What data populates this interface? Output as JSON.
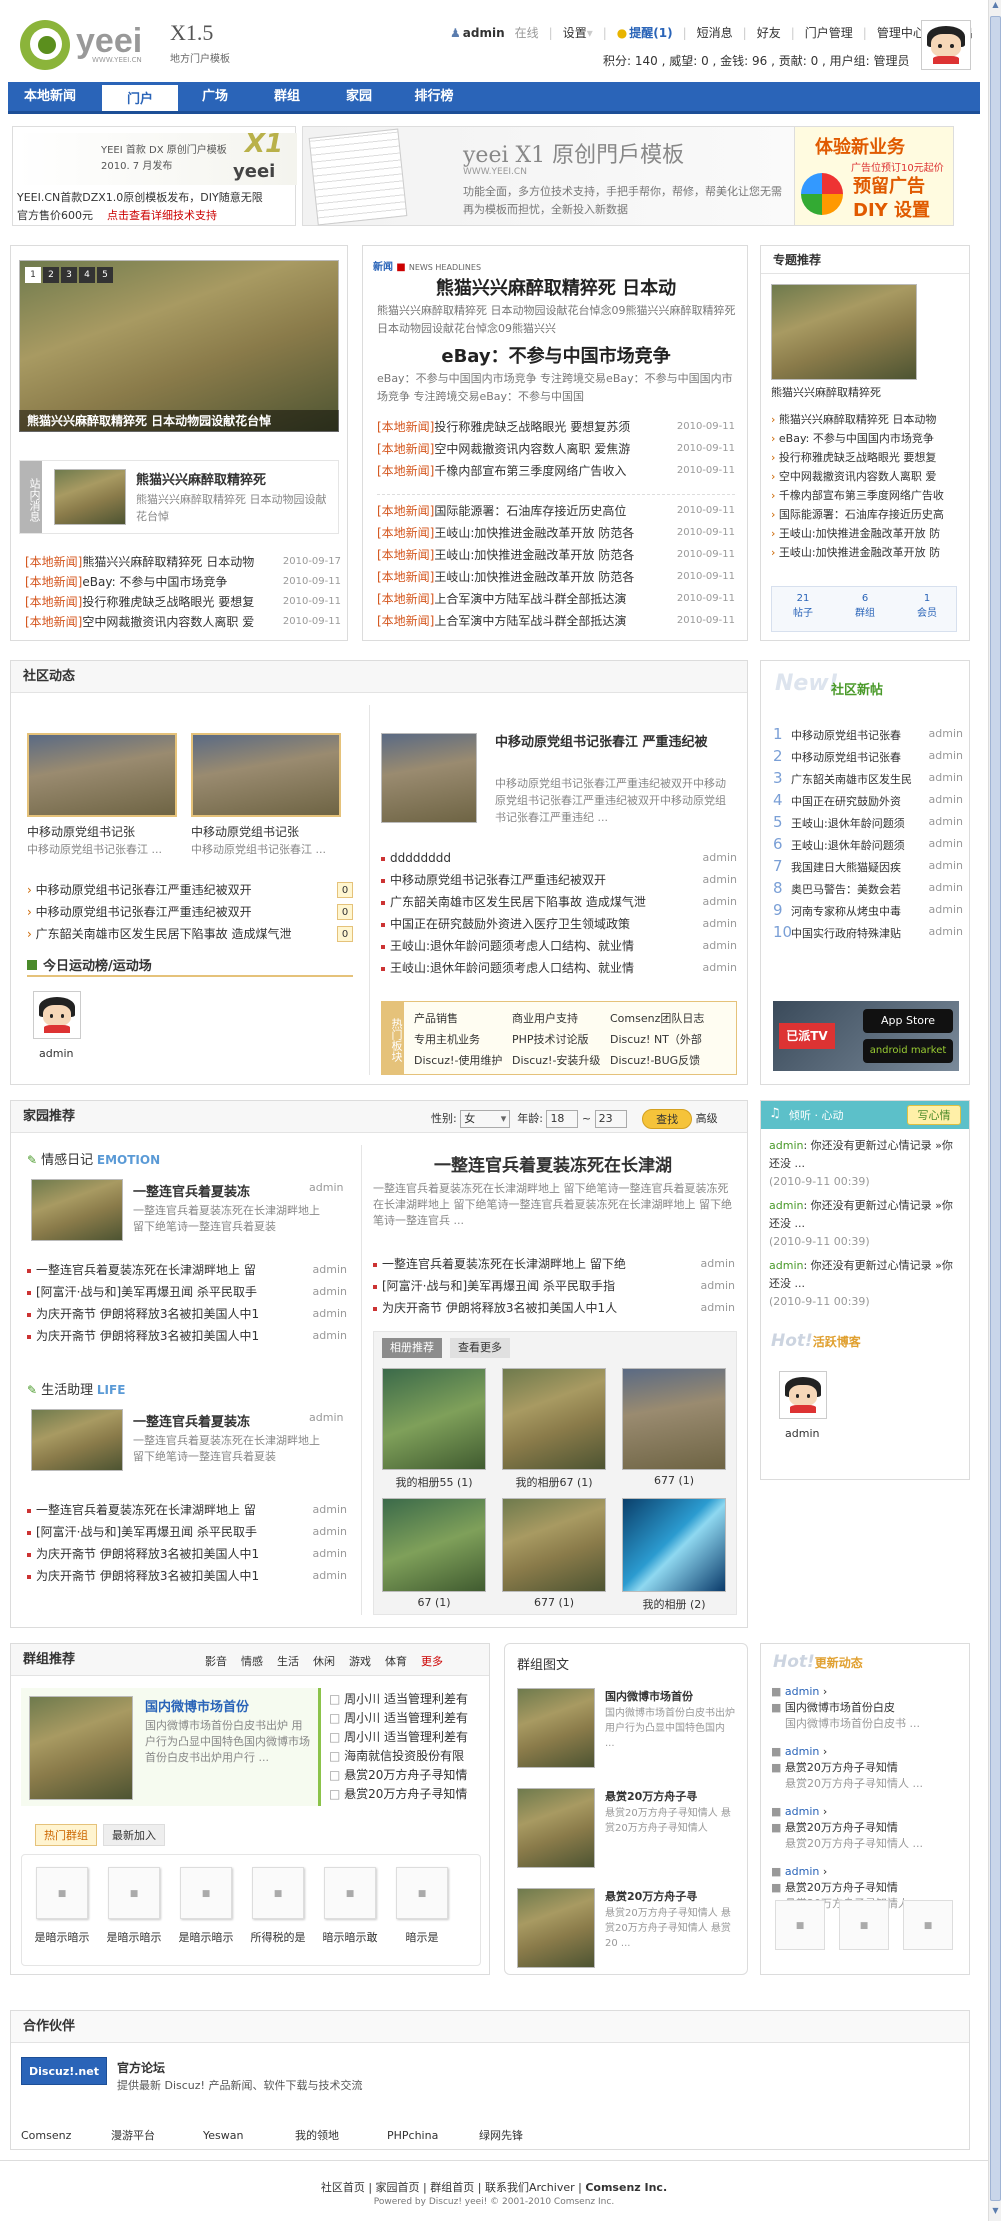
{
  "header": {
    "logo_text": "yeei",
    "logo_ver": "X1.5",
    "logo_sub": "地方门户模板",
    "logo_url": "WWW.YEEI.CN",
    "user": "admin",
    "online": "在线",
    "settings": "设置",
    "remind": "提醒(1)",
    "sms": "短消息",
    "friends": "好友",
    "portal_admin": "门户管理",
    "admin_center": "管理中心",
    "logout": "退出",
    "stats": "积分: 140 , 威望: 0 , 金钱: 96 , 贡献: 0 , 用户组: 管理员"
  },
  "nav": [
    "本地新闻",
    "门户",
    "广场",
    "群组",
    "家园",
    "排行榜"
  ],
  "ads": {
    "a1_title": "YEEI 首款 DX 原创门户模板",
    "a1_date": "2010. 7 月发布",
    "a1_x1": "X1",
    "a1_logo": "yeei",
    "a1_line1": "YEEI.CN首款DZX1.0原创模板发布，DIY随意无限",
    "a1_line2": "官方售价600元",
    "a1_link": "点击查看详细技术支持",
    "a2_title": "yeei X1 原创門戶模板",
    "a2_url": "WWW.YEEI.CN",
    "a2_text": "功能全面，多方位技术支持，手把手帮你，帮修，帮美化让您无需再为模板而担忧，全新投入新数据",
    "a3_title": "体验新业务",
    "a3_sub": "广告位预订10元起价",
    "a3_big": "预留广告 DIY 设置"
  },
  "slider": {
    "nums": [
      "1",
      "2",
      "3",
      "4",
      "5"
    ],
    "caption": "熊猫兴兴麻醉取精猝死  日本动物园设献花台悼"
  },
  "station": {
    "tab": "站内消息",
    "title": "熊猫兴兴麻醉取精猝死",
    "desc": "熊猫兴兴麻醉取精猝死 日本动物园设献花台悼",
    "items": [
      {
        "tag": "[本地新闻]",
        "t": "熊猫兴兴麻醉取精猝死 日本动物",
        "d": "2010-09-17"
      },
      {
        "tag": "[本地新闻]",
        "t": "eBay: 不参与中国市场竞争",
        "d": "2010-09-11"
      },
      {
        "tag": "[本地新闻]",
        "t": "投行称雅虎缺乏战略眼光 要想复",
        "d": "2010-09-11"
      },
      {
        "tag": "[本地新闻]",
        "t": "空中网裁撤资讯内容数人离职 爱",
        "d": "2010-09-11"
      }
    ]
  },
  "news": {
    "label": "新闻",
    "label2": "NEWS HEADLINES",
    "head1": "熊猫兴兴麻醉取精猝死  日本动",
    "sum1": "熊猫兴兴麻醉取精猝死 日本动物园设献花台悼念09熊猫兴兴麻醉取精猝死 日本动物园设献花台悼念09熊猫兴兴",
    "head2": "eBay：不参与中国市场竞争",
    "sum2": "eBay：不参与中国国内市场竞争 专注跨境交易eBay：不参与中国国内市场竞争 专注跨境交易eBay：不参与中国国",
    "list1": [
      {
        "tag": "[本地新闻]",
        "t": "投行称雅虎缺乏战略眼光 要想复苏须",
        "d": "2010-09-11"
      },
      {
        "tag": "[本地新闻]",
        "t": "空中网裁撤资讯内容数人离职 爱焦游",
        "d": "2010-09-11"
      },
      {
        "tag": "[本地新闻]",
        "t": "千橡内部宣布第三季度网络广告收入",
        "d": "2010-09-11"
      }
    ],
    "list2": [
      {
        "tag": "[本地新闻]",
        "t": "国际能源署：石油库存接近历史高位",
        "d": "2010-09-11"
      },
      {
        "tag": "[本地新闻]",
        "t": "王岐山:加快推进金融改革开放 防范各",
        "d": "2010-09-11"
      },
      {
        "tag": "[本地新闻]",
        "t": "王岐山:加快推进金融改革开放 防范各",
        "d": "2010-09-11"
      },
      {
        "tag": "[本地新闻]",
        "t": "王岐山:加快推进金融改革开放 防范各",
        "d": "2010-09-11"
      },
      {
        "tag": "[本地新闻]",
        "t": "上合军演中方陆军战斗群全部抵达演",
        "d": "2010-09-11"
      },
      {
        "tag": "[本地新闻]",
        "t": "上合军演中方陆军战斗群全部抵达演",
        "d": "2010-09-11"
      }
    ]
  },
  "topic": {
    "title": "专题推荐",
    "caption": "熊猫兴兴麻醉取精猝死",
    "items": [
      "熊猫兴兴麻醉取精猝死 日本动物",
      "eBay: 不参与中国国内市场竞争",
      "投行称雅虎缺乏战略眼光 要想复",
      "空中网裁撤资讯内容数人离职 爱",
      "千橡内部宣布第三季度网络广告收",
      "国际能源署：石油库存接近历史高",
      "王岐山:加快推进金融改革开放 防",
      "王岐山:加快推进金融改革开放 防"
    ],
    "stats": [
      {
        "n": "21",
        "l": "帖子"
      },
      {
        "n": "6",
        "l": "群组"
      },
      {
        "n": "1",
        "l": "会员"
      }
    ]
  },
  "community": {
    "title": "社区动态",
    "pic1": "中移动原党组书记张",
    "pic1b": "中移动原党组书记张春江 ...",
    "pic2": "中移动原党组书记张",
    "pic2b": "中移动原党组书记张春江 ...",
    "list": [
      {
        "t": "中移动原党组书记张春江严重违纪被双开",
        "n": "0"
      },
      {
        "t": "中移动原党组书记张春江严重违纪被双开",
        "n": "0"
      },
      {
        "t": "广东韶关南雄市区发生民居下陷事故 造成煤气泄",
        "n": "0"
      }
    ],
    "today": "今日运动榜/运动场",
    "today_user": "admin",
    "feat_title": "中移动原党组书记张春江 严重违纪被",
    "feat_desc": "中移动原党组书记张春江严重违纪被双开中移动原党组书记张春江严重违纪被双开中移动原党组书记张春江严重违纪 ...",
    "list2": [
      {
        "t": "dddddddd",
        "u": "admin"
      },
      {
        "t": "中移动原党组书记张春江严重违纪被双开",
        "u": "admin"
      },
      {
        "t": "广东韶关南雄市区发生民居下陷事故 造成煤气泄",
        "u": "admin"
      },
      {
        "t": "中国正在研究鼓励外资进入医疗卫生领域政策",
        "u": "admin"
      },
      {
        "t": "王岐山:退休年龄问题须考虑人口结构、就业情",
        "u": "admin"
      },
      {
        "t": "王岐山:退休年龄问题须考虑人口结构、就业情",
        "u": "admin"
      }
    ],
    "hot_tab": "热门板块",
    "hot": [
      [
        "产品销售",
        "商业用户支持",
        "Comsenz团队日志"
      ],
      [
        "专用主机业务",
        "PHP技术讨论版",
        "Discuz! NT（外部"
      ],
      [
        "Discuz!-使用维护",
        "Discuz!-安装升级",
        "Discuz!-BUG反馈"
      ]
    ]
  },
  "new_posts": {
    "title": "社区新帖",
    "items": [
      {
        "n": "1",
        "t": "中移动原党组书记张春",
        "u": "admin"
      },
      {
        "n": "2",
        "t": "中移动原党组书记张春",
        "u": "admin"
      },
      {
        "n": "3",
        "t": "广东韶关南雄市区发生民",
        "u": "admin"
      },
      {
        "n": "4",
        "t": "中国正在研究鼓励外资",
        "u": "admin"
      },
      {
        "n": "5",
        "t": "王岐山:退休年龄问题须",
        "u": "admin"
      },
      {
        "n": "6",
        "t": "王岐山:退休年龄问题须",
        "u": "admin"
      },
      {
        "n": "7",
        "t": "我国建日大熊猫疑因疾",
        "u": "admin"
      },
      {
        "n": "8",
        "t": "奥巴马警告：美数会若",
        "u": "admin"
      },
      {
        "n": "9",
        "t": "河南专家称从烤虫中毒",
        "u": "admin"
      },
      {
        "n": "10",
        "t": "中国实行政府特殊津贴",
        "u": "admin"
      }
    ],
    "app_store": "App Store",
    "android": "android market",
    "brand": "已派TV"
  },
  "home": {
    "title": "家园推荐",
    "gender_label": "性别:",
    "gender": "女",
    "age_label": "年龄:",
    "age_from": "18",
    "age_to": "23",
    "search": "查找",
    "advanced": "高级",
    "cat1": "情感日记",
    "cat1_en": "EMOTION",
    "feat1_title": "一整连官兵着夏装冻",
    "feat1_user": "admin",
    "feat1_desc": "一整连官兵着夏装冻死在长津湖畔地上 留下绝笔诗一整连官兵着夏装",
    "list1": [
      {
        "t": "一整连官兵着夏装冻死在长津湖畔地上 留",
        "u": "admin"
      },
      {
        "t": "[阿富汗·战与和]美军再爆丑闻 杀平民取手",
        "u": "admin"
      },
      {
        "t": "为庆开斋节 伊朗将释放3名被扣美国人中1",
        "u": "admin"
      },
      {
        "t": "为庆开斋节 伊朗将释放3名被扣美国人中1",
        "u": "admin"
      }
    ],
    "cat2": "生活助理",
    "cat2_en": "LIFE",
    "feat2_title": "一整连官兵着夏装冻",
    "feat2_user": "admin",
    "feat2_desc": "一整连官兵着夏装冻死在长津湖畔地上 留下绝笔诗一整连官兵着夏装",
    "list2": [
      {
        "t": "一整连官兵着夏装冻死在长津湖畔地上 留",
        "u": "admin"
      },
      {
        "t": "[阿富汗·战与和]美军再爆丑闻 杀平民取手",
        "u": "admin"
      },
      {
        "t": "为庆开斋节 伊朗将释放3名被扣美国人中1",
        "u": "admin"
      },
      {
        "t": "为庆开斋节 伊朗将释放3名被扣美国人中1",
        "u": "admin"
      }
    ],
    "center_title": "一整连官兵着夏装冻死在长津湖",
    "center_desc": "一整连官兵着夏装冻死在长津湖畔地上 留下绝笔诗一整连官兵着夏装冻死在长津湖畔地上 留下绝笔诗一整连官兵着夏装冻死在长津湖畔地上 留下绝笔诗一整连官兵 ...",
    "center_list": [
      {
        "t": "一整连官兵着夏装冻死在长津湖畔地上 留下绝",
        "u": "admin"
      },
      {
        "t": "[阿富汗·战与和]美军再爆丑闻 杀平民取手指",
        "u": "admin"
      },
      {
        "t": "为庆开斋节 伊朗将释放3名被扣美国人中1人",
        "u": "admin"
      }
    ],
    "album_tab": "相册推荐",
    "album_more": "查看更多",
    "albums": [
      "我的相册55 (1)",
      "我的相册67 (1)",
      "677 (1)",
      "67 (1)",
      "677 (1)",
      "我的相册 (2)"
    ]
  },
  "mood": {
    "title": "倾听 · 心动",
    "button": "写心情",
    "items": [
      {
        "u": "admin",
        "t": ": 你还没有更新过心情记录 &raquo;你还没 ...",
        "d": "(2010-9-11 00:39)"
      },
      {
        "u": "admin",
        "t": ": 你还没有更新过心情记录 &raquo;你还没 ...",
        "d": "(2010-9-11 00:39)"
      },
      {
        "u": "admin",
        "t": ": 你还没有更新过心情记录 &raquo;你还没 ...",
        "d": "(2010-9-11 00:39)"
      }
    ],
    "hot_title": "活跃博客",
    "hot_en": "Hot!",
    "hot_user": "admin"
  },
  "groups": {
    "title": "群组推荐",
    "cats": [
      "影音",
      "情感",
      "生活",
      "休闲",
      "游戏",
      "体育",
      "更多"
    ],
    "feat_title": "国内微博市场首份",
    "feat_desc": "国内微博市场首份白皮书出炉 用户行为凸显中国特色国内微博市场首份白皮书出炉用户行 ...",
    "list": [
      {
        "u": "周小川",
        "t": "适当管理利差有"
      },
      {
        "u": "周小川",
        "t": "适当管理利差有"
      },
      {
        "u": "周小川",
        "t": "适当管理利差有"
      },
      {
        "u": "",
        "t": "海南就信投资股份有限"
      },
      {
        "u": "",
        "t": "悬赏20万方舟子寻知情"
      },
      {
        "u": "",
        "t": "悬赏20万方舟子寻知情"
      }
    ],
    "tab_hot": "热门群组",
    "tab_new": "最新加入",
    "thumbs": [
      "是暗示暗示",
      "是暗示暗示",
      "是暗示暗示",
      "所得税的是",
      "暗示暗示敢",
      "暗示是"
    ]
  },
  "group_pics": {
    "title": "群组图文",
    "items": [
      {
        "t": "国内微博市场首份",
        "d": "国内微博市场首份白皮书出炉 用户行为凸显中国特色国内 ..."
      },
      {
        "t": "悬赏20万方舟子寻",
        "d": "悬赏20万方舟子寻知情人 悬赏20万方舟子寻知情人"
      },
      {
        "t": "悬赏20万方舟子寻",
        "d": "悬赏20万方舟子寻知情人 悬赏20万方舟子寻知情人 悬赏20 ..."
      }
    ]
  },
  "updates": {
    "title": "更新动态",
    "hot_en": "Hot!",
    "items": [
      {
        "u": "admin",
        "t": "国内微博市场首份白皮",
        "d": "国内微博市场首份白皮书 ..."
      },
      {
        "u": "admin",
        "t": "悬赏20万方舟子寻知情",
        "d": "悬赏20万方舟子寻知情人 ..."
      },
      {
        "u": "admin",
        "t": "悬赏20万方舟子寻知情",
        "d": "悬赏20万方舟子寻知情人 ..."
      },
      {
        "u": "admin",
        "t": "悬赏20万方舟子寻知情",
        "d": "悬赏20万方舟子寻知情人 ..."
      }
    ]
  },
  "partners": {
    "title": "合作伙伴",
    "feat_name": "官方论坛",
    "feat_desc": "提供最新 Discuz! 产品新闻、软件下载与技术交流",
    "feat_logo": "Discuz!.net",
    "links": [
      "Comsenz",
      "漫游平台",
      "Yeswan",
      "我的领地",
      "PHPchina",
      "绿网先锋"
    ]
  },
  "footer": {
    "links": [
      "社区首页",
      "家园首页",
      "群组首页",
      "联系我们",
      "Archiver"
    ],
    "brand": "Comsenz Inc.",
    "powered": "Powered by Discuz! yeei! © 2001-2010 Comsenz Inc."
  }
}
